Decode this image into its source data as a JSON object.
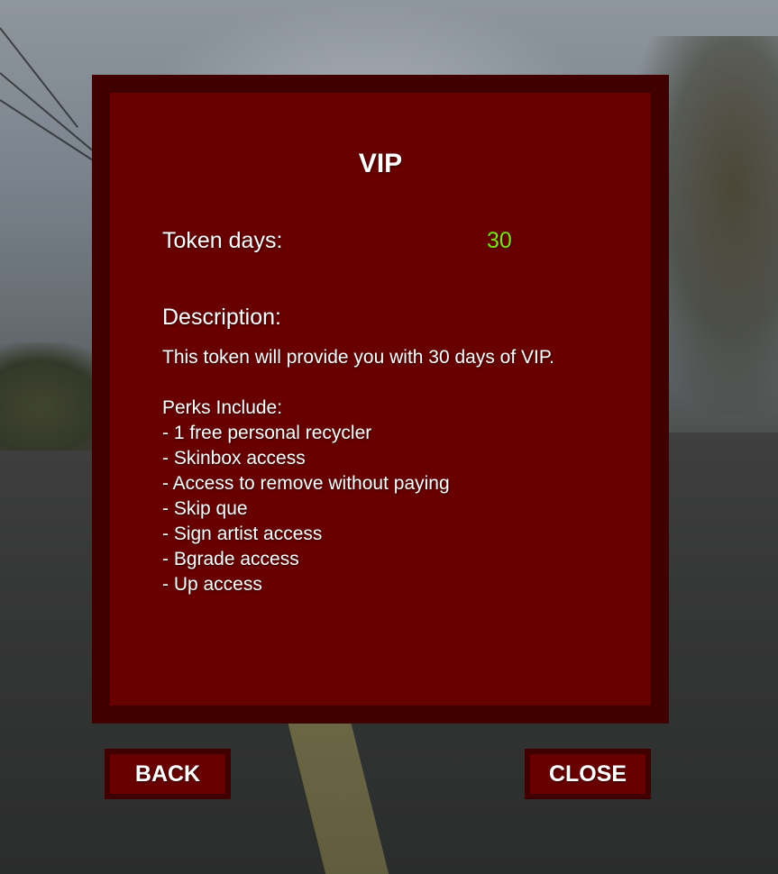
{
  "panel": {
    "title": "VIP",
    "token_days_label": "Token days:",
    "token_days_value": "30",
    "description_heading": "Description:",
    "description_lines": [
      "This token will provide you with 30 days of VIP.",
      "",
      "Perks Include:",
      "- 1 free personal recycler",
      "- Skinbox access",
      "- Access to remove without paying",
      "- Skip que",
      "- Sign artist access",
      "- Bgrade access",
      "- Up access"
    ]
  },
  "buttons": {
    "back_label": "BACK",
    "close_label": "CLOSE"
  },
  "colors": {
    "panel_border": "#400000",
    "panel_fill": "#680000",
    "token_value": "#7fe020",
    "text": "#ffffff"
  }
}
